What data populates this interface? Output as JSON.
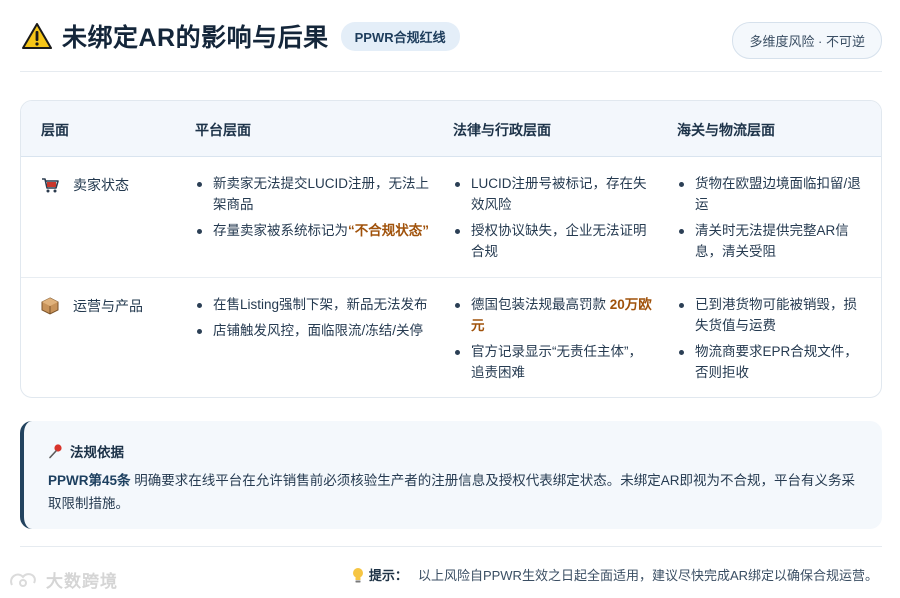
{
  "header": {
    "title": "未绑定AR的影响与后果",
    "tag": "PPWR合规红线",
    "risk_label": "多维度风险 · 不可逆"
  },
  "table": {
    "columns": [
      "层面",
      "平台层面",
      "法律与行政层面",
      "海关与物流层面"
    ],
    "rows": [
      {
        "label": "卖家状态",
        "icon": "shopping-cart-icon",
        "platform": [
          "新卖家无法提交LUCID注册，无法上架商品",
          "存量卖家被系统标记为“不合规状态”"
        ],
        "platform_highlight": "不合规状态",
        "legal": [
          "LUCID注册号被标记，存在失效风险",
          "授权协议缺失，企业无法证明合规"
        ],
        "customs": [
          "货物在欧盟边境面临扣留/退运",
          "清关时无法提供完整AR信息，清关受阻"
        ]
      },
      {
        "label": "运营与产品",
        "icon": "package-box-icon",
        "platform": [
          "在售Listing强制下架，新品无法发布",
          "店铺触发风控，面临限流/冻结/关停"
        ],
        "legal": [
          "德国包装法规最高罚款 20万欧元",
          "官方记录显示“无责任主体”，追责困难"
        ],
        "legal_highlight": "20万欧元",
        "customs": [
          "已到港货物可能被销毁，损失货值与运费",
          "物流商要求EPR合规文件，否则拒收"
        ]
      }
    ]
  },
  "basis": {
    "title": "法规依据",
    "article": "PPWR第45条",
    "text": "明确要求在线平台在允许销售前必须核验生产者的注册信息及授权代表绑定状态。未绑定AR即视为不合规，平台有义务采取限制措施。"
  },
  "footer": {
    "watermark": "大数跨境",
    "tip_label": "提示：",
    "tip_text": "以上风险自PPWR生效之日起全面适用，建议尽快完成AR绑定以确保合规运营。"
  },
  "colors": {
    "accent_dark": "#22435f",
    "highlight": "#a0520b",
    "warning": "#f5c518"
  }
}
